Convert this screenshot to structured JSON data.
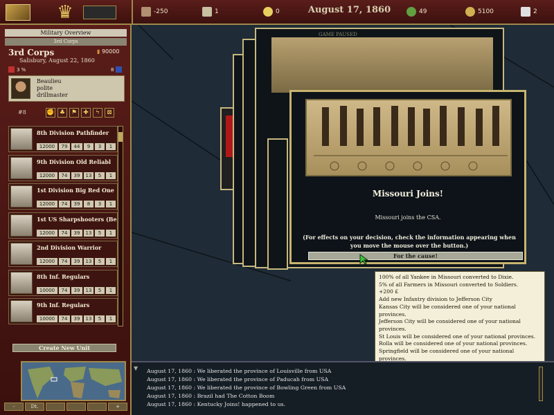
{
  "topbar": {
    "resources": [
      {
        "value": "-250",
        "color": "#b09070",
        "icon": "prestige-icon"
      },
      {
        "value": "1",
        "color": "#c8c0a0",
        "icon": "crossed-swords-icon"
      },
      {
        "value": "0",
        "color": "#e8d060",
        "icon": "lightbulb-icon"
      },
      {
        "value": "49",
        "color": "#60a040",
        "icon": "laurel-icon"
      },
      {
        "value": "5100",
        "color": "#d0b050",
        "icon": "money-bag-icon"
      },
      {
        "value": "2",
        "color": "#e0e0e0",
        "icon": "messages-icon"
      }
    ],
    "date": "August 17, 1860"
  },
  "panel": {
    "title": "Military Overview",
    "tab": "3rd Corps",
    "corps_name": "3rd Corps",
    "corps_men": "90000",
    "corps_location": "Salisbury, August 22, 1860",
    "morale": "3 %",
    "supply": "8",
    "leader": {
      "name": "Beaulieu",
      "trait1": "polite",
      "trait2": "drillmaster"
    },
    "unit_count": "#8",
    "create_button": "Create New Unit",
    "minimap_buttons": [
      "-",
      "Dt.",
      "",
      "",
      "",
      "+"
    ]
  },
  "units": [
    {
      "name": "8th Division Pathfinder",
      "stats": [
        "12000",
        "79",
        "44",
        "9",
        "3",
        "1"
      ]
    },
    {
      "name": "9th Division Old Reliabl",
      "stats": [
        "12000",
        "74",
        "39",
        "13",
        "5",
        "1"
      ]
    },
    {
      "name": "1st Division Big Red One",
      "stats": [
        "12000",
        "74",
        "39",
        "8",
        "3",
        "1"
      ]
    },
    {
      "name": "1st US Sharpshooters (Be",
      "stats": [
        "12000",
        "74",
        "39",
        "13",
        "5",
        "1"
      ]
    },
    {
      "name": "2nd Division Warrior",
      "stats": [
        "12000",
        "74",
        "39",
        "13",
        "5",
        "1"
      ]
    },
    {
      "name": "8th Inf. Regulars",
      "stats": [
        "10000",
        "74",
        "39",
        "13",
        "5",
        "1"
      ]
    },
    {
      "name": "9th Inf. Regulars",
      "stats": [
        "10000",
        "74",
        "39",
        "13",
        "5",
        "1"
      ]
    }
  ],
  "event": {
    "stacked_label": "GAME PAUSED",
    "title": "Missouri Joins!",
    "description": "Missouri joins the CSA.",
    "hint": "(For effects on your decision, check the information appearing when you move the mouse over the button.)",
    "choice": "For the cause!"
  },
  "tooltip": [
    "100% of all Yankee in Missouri converted to Dixie.",
    "5% of all Farmers in Missouri converted to Soldiers.",
    "+200 £",
    "Add new Infantry division to Jefferson City",
    "Kansas City will be considered one of your national provinces.",
    "Jefferson City will be considered one of your national provinces.",
    "St Louis will be considered one of your national provinces.",
    "Rolla will be considered one of your national provinces.",
    "Springfield will be considered one of your national provinces."
  ],
  "log": [
    "August 17, 1860 : We liberated the province of Louisville from USA",
    "August 17, 1860 : We liberated the province of Paducah from USA",
    "August 17, 1860 : We liberated the province of Bowling Green from USA",
    "August 17, 1860 : Brazil had The Cotton Boom",
    "August 17, 1860 : Kentucky Joins! happened to us."
  ]
}
